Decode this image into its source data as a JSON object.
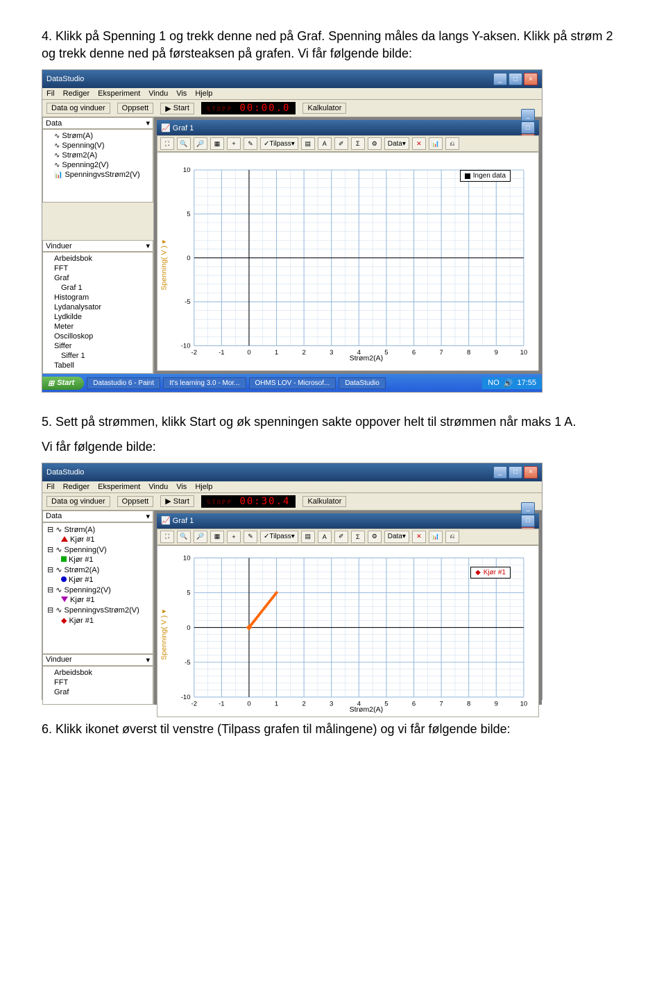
{
  "paragraphs": {
    "p4": "4. Klikk på Spenning 1 og trekk denne ned på Graf. Spenning måles da langs Y-aksen. Klikk på strøm 2 og trekk denne ned på førsteaksen på grafen. Vi får følgende bilde:",
    "p5": "5. Sett på strømmen, klikk Start og øk spenningen sakte oppover helt til strømmen når maks 1 A.",
    "p5b": "Vi får følgende bilde:",
    "p6": "6. Klikk ikonet øverst til venstre (Tilpass grafen til målingene) og vi får følgende bilde:"
  },
  "app": {
    "title": "DataStudio",
    "menus": [
      "Fil",
      "Rediger",
      "Eksperiment",
      "Vindu",
      "Vis",
      "Hjelp"
    ],
    "toolbar": {
      "data_windows": "Data og vinduer",
      "setup": "Oppsett",
      "start": "Start",
      "stop": "STOPP",
      "calc": "Kalkulator"
    }
  },
  "timer1": "00:00.0",
  "timer2": "00:30.4",
  "left_panels": {
    "data": "Data",
    "windows": "Vinduer"
  },
  "data_tree1": [
    "Strøm(A)",
    "Spenning(V)",
    "Strøm2(A)",
    "Spenning2(V)",
    "SpenningvsStrøm2(V)"
  ],
  "data_tree2": [
    {
      "label": "Strøm(A)",
      "sub": "Kjør #1",
      "shape": "tri",
      "color": "#c00"
    },
    {
      "label": "Spenning(V)",
      "sub": "Kjør #1",
      "shape": "sq",
      "color": "#0a0"
    },
    {
      "label": "Strøm2(A)",
      "sub": "Kjør #1",
      "shape": "dot",
      "color": "#00c"
    },
    {
      "label": "Spenning2(V)",
      "sub": "Kjør #1",
      "shape": "tri-dn",
      "color": "#a0a"
    },
    {
      "label": "SpenningvsStrøm2(V)",
      "sub": "Kjør #1",
      "shape": "dia",
      "color": "#c00"
    }
  ],
  "windows_tree": [
    "Arbeidsbok",
    "FFT",
    "Graf",
    "Graf 1",
    "Histogram",
    "Lydanalysator",
    "Lydkilde",
    "Meter",
    "Oscilloskop",
    "Siffer",
    "Siffer 1",
    "Tabell"
  ],
  "windows_tree_short": [
    "Arbeidsbok",
    "FFT",
    "Graf"
  ],
  "graph": {
    "title": "Graf 1",
    "fit": "Tilpass",
    "data": "Data",
    "xlabel": "Strøm2(A)",
    "ylabel": "Spenning( V )",
    "legend1": "Ingen data",
    "legend2": "Kjør #1"
  },
  "taskbar": {
    "start": "Start",
    "items": [
      "Datastudio 6 - Paint",
      "It's learning 3.0 - Mor...",
      "OHMS LOV - Microsof...",
      "DataStudio"
    ],
    "lang": "NO",
    "time": "17:55"
  },
  "chart_data": [
    {
      "type": "scatter",
      "title": "Graf 1",
      "xlabel": "Strøm2(A)",
      "ylabel": "Spenning( V )",
      "xlim": [
        -2,
        10
      ],
      "ylim": [
        -10,
        10
      ],
      "xticks": [
        -2,
        -1,
        0,
        1,
        2,
        3,
        4,
        5,
        6,
        7,
        8,
        9,
        10
      ],
      "yticks": [
        -10,
        -5,
        0,
        5,
        10
      ],
      "series": [],
      "legend": "Ingen data"
    },
    {
      "type": "scatter",
      "title": "Graf 1",
      "xlabel": "Strøm2(A)",
      "ylabel": "Spenning( V )",
      "xlim": [
        -2,
        10
      ],
      "ylim": [
        -10,
        10
      ],
      "xticks": [
        -2,
        -1,
        0,
        1,
        2,
        3,
        4,
        5,
        6,
        7,
        8,
        9,
        10
      ],
      "yticks": [
        -10,
        -5,
        0,
        5,
        10
      ],
      "series": [
        {
          "name": "Kjør #1",
          "color": "#ff6600",
          "x": [
            0,
            0.05,
            0.1,
            0.15,
            0.2,
            0.25,
            0.3,
            0.35,
            0.4,
            0.45,
            0.5,
            0.55,
            0.6,
            0.65,
            0.7,
            0.75,
            0.8,
            0.85,
            0.9,
            0.95,
            1.0
          ],
          "y": [
            0,
            0.25,
            0.5,
            0.75,
            1.0,
            1.25,
            1.5,
            1.75,
            2.0,
            2.25,
            2.5,
            2.75,
            3.0,
            3.25,
            3.5,
            3.75,
            4.0,
            4.25,
            4.5,
            4.75,
            5.0
          ]
        }
      ],
      "legend": "Kjør #1"
    }
  ]
}
